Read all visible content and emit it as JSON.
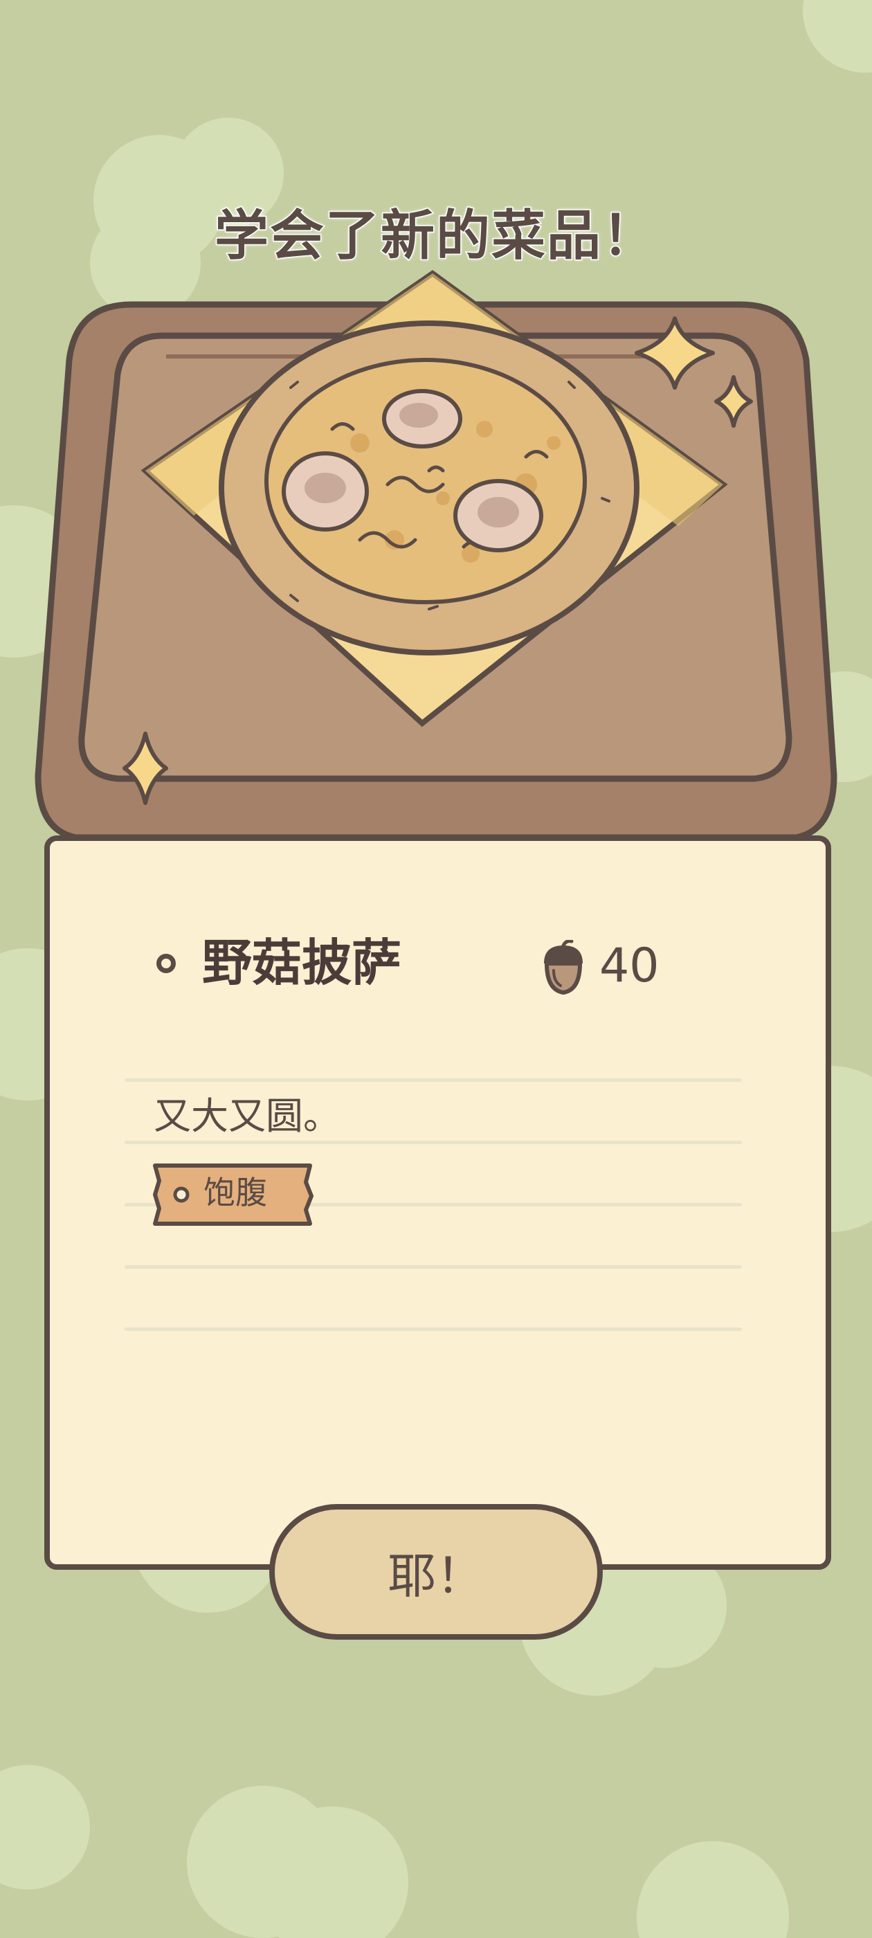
{
  "banner": {
    "title": "学会了新的菜品！"
  },
  "dish": {
    "name": "野菇披萨",
    "price": "40",
    "price_icon": "acorn-icon",
    "description": "又大又圆。",
    "tag": "饱腹"
  },
  "actions": {
    "confirm_label": "耶！"
  },
  "colors": {
    "background": "#c4cea1",
    "card": "#fbf0d2",
    "outline": "#5a4b45",
    "tray": "#b9977b",
    "button": "#e8d2a8",
    "tag": "#e4b07d"
  }
}
